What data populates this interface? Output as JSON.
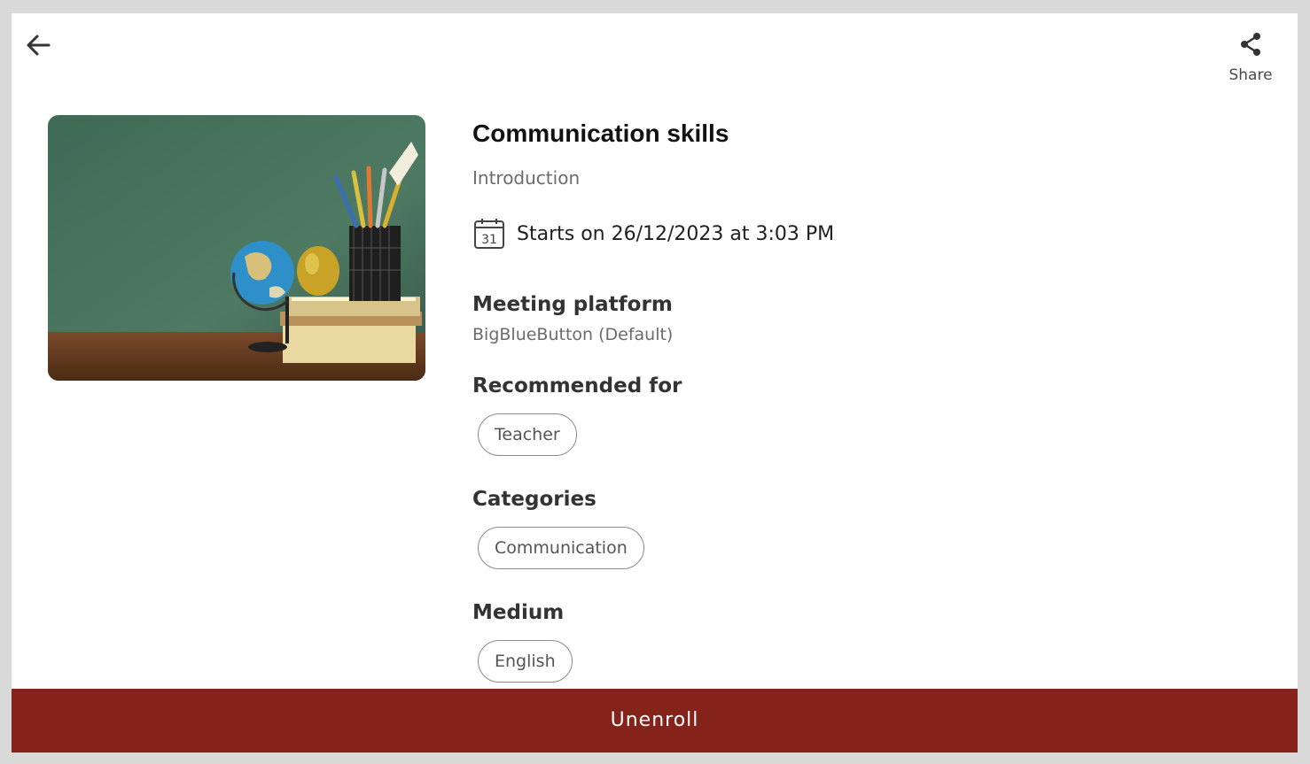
{
  "header": {
    "back_icon": "arrow-left-icon",
    "share_icon": "share-icon",
    "share_label": "Share"
  },
  "course": {
    "title": "Communication skills",
    "subtitle": "Introduction",
    "date_icon": "calendar-icon",
    "calendar_day": "31",
    "start_text": "Starts on 26/12/2023 at 3:03 PM"
  },
  "sections": {
    "platform": {
      "title": "Meeting platform",
      "value": "BigBlueButton (Default)"
    },
    "recommended": {
      "title": "Recommended for",
      "chip": "Teacher"
    },
    "categories": {
      "title": "Categories",
      "chip": "Communication"
    },
    "medium": {
      "title": "Medium",
      "chip": "English"
    }
  },
  "footer": {
    "action_label": "Unenroll"
  },
  "colors": {
    "accent": "#852219",
    "background": "#d9d9d9"
  }
}
